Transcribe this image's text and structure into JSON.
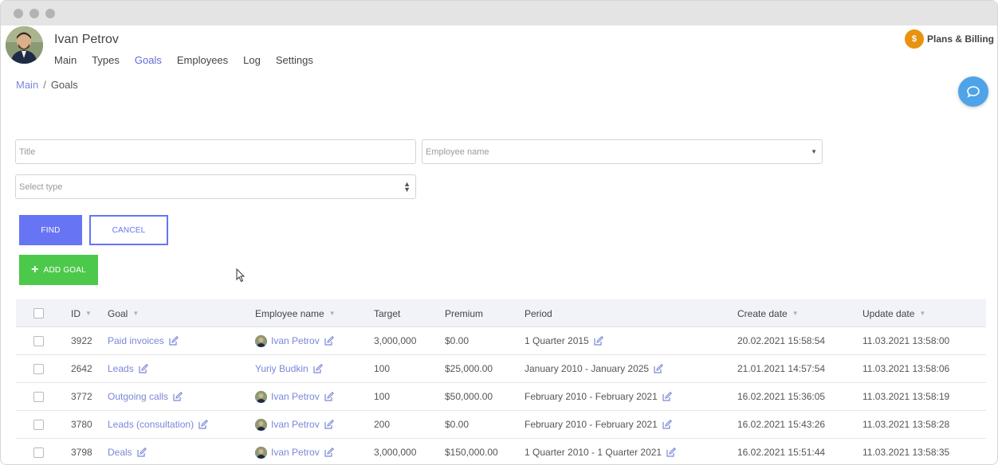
{
  "user": {
    "name": "Ivan Petrov"
  },
  "nav": [
    {
      "label": "Main",
      "active": false
    },
    {
      "label": "Types",
      "active": false
    },
    {
      "label": "Goals",
      "active": true
    },
    {
      "label": "Employees",
      "active": false
    },
    {
      "label": "Log",
      "active": false
    },
    {
      "label": "Settings",
      "active": false
    }
  ],
  "billing": {
    "icon": "dollar-coin-icon",
    "symbol": "$",
    "label": "Plans & Billing"
  },
  "breadcrumb": {
    "root": "Main",
    "separator": "/",
    "current": "Goals"
  },
  "filters": {
    "title_placeholder": "Title",
    "employee_placeholder": "Employee name",
    "type_placeholder": "Select type"
  },
  "buttons": {
    "find": "FIND",
    "cancel": "CANCEL",
    "add_goal": "ADD GOAL"
  },
  "table": {
    "headers": {
      "id": "ID",
      "goal": "Goal",
      "employee": "Employee name",
      "target": "Target",
      "premium": "Premium",
      "period": "Period",
      "create_date": "Create date",
      "update_date": "Update date"
    },
    "rows": [
      {
        "id": "3922",
        "goal": "Paid invoices",
        "employee": "Ivan Petrov",
        "has_avatar": true,
        "target": "3,000,000",
        "premium": "$0.00",
        "period": "1 Quarter 2015",
        "create_date": "20.02.2021 15:58:54",
        "update_date": "11.03.2021 13:58:00"
      },
      {
        "id": "2642",
        "goal": "Leads",
        "employee": "Yuriy Budkin",
        "has_avatar": false,
        "target": "100",
        "premium": "$25,000.00",
        "period": "January 2010 - January 2025",
        "create_date": "21.01.2021 14:57:54",
        "update_date": "11.03.2021 13:58:06"
      },
      {
        "id": "3772",
        "goal": "Outgoing calls",
        "employee": "Ivan Petrov",
        "has_avatar": true,
        "target": "100",
        "premium": "$50,000.00",
        "period": "February 2010 - February 2021",
        "create_date": "16.02.2021 15:36:05",
        "update_date": "11.03.2021 13:58:19"
      },
      {
        "id": "3780",
        "goal": "Leads (consultation)",
        "employee": "Ivan Petrov",
        "has_avatar": true,
        "target": "200",
        "premium": "$0.00",
        "period": "February 2010 - February 2021",
        "create_date": "16.02.2021 15:43:26",
        "update_date": "11.03.2021 13:58:28"
      },
      {
        "id": "3798",
        "goal": "Deals",
        "employee": "Ivan Petrov",
        "has_avatar": true,
        "target": "3,000,000",
        "premium": "$150,000.00",
        "period": "1 Quarter 2010 - 1 Quarter 2021",
        "create_date": "16.02.2021 15:51:44",
        "update_date": "11.03.2021 13:58:35"
      }
    ]
  },
  "colors": {
    "accent": "#6774f3",
    "link": "#7a87d9",
    "success": "#4cc94a",
    "billing": "#e8930f",
    "chat": "#4fa3e8"
  }
}
